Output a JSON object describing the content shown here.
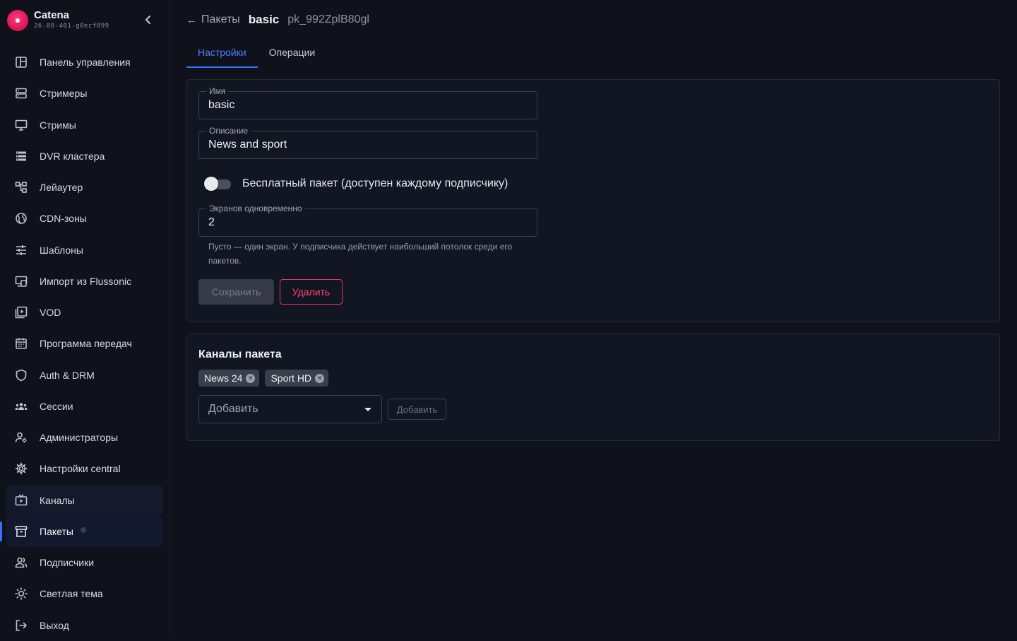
{
  "brand": {
    "name": "Catena",
    "version": "26.08-401-g0ecf899",
    "logo_color": "#d8154f"
  },
  "sidebar": {
    "items": [
      {
        "label": "Панель управления",
        "icon": "dashboard-icon"
      },
      {
        "label": "Стримеры",
        "icon": "server-icon"
      },
      {
        "label": "Стримы",
        "icon": "monitor-icon"
      },
      {
        "label": "DVR кластера",
        "icon": "storage-icon"
      },
      {
        "label": "Лейаутер",
        "icon": "layout-tree-icon"
      },
      {
        "label": "CDN-зоны",
        "icon": "globe-icon"
      },
      {
        "label": "Шаблоны",
        "icon": "sliders-icon"
      },
      {
        "label": "Импорт из Flussonic",
        "icon": "import-icon"
      },
      {
        "label": "VOD",
        "icon": "video-library-icon"
      },
      {
        "label": "Программа передач",
        "icon": "calendar-icon"
      },
      {
        "label": "Auth & DRM",
        "icon": "shield-icon"
      },
      {
        "label": "Сессии",
        "icon": "groups-icon"
      },
      {
        "label": "Администраторы",
        "icon": "admin-icon"
      },
      {
        "label": "Настройки central",
        "icon": "gear-icon"
      },
      {
        "label": "Каналы",
        "icon": "tv-icon"
      },
      {
        "label": "Пакеты",
        "icon": "package-icon"
      },
      {
        "label": "Подписчики",
        "icon": "people-icon"
      },
      {
        "label": "Светлая тема",
        "icon": "sun-icon"
      },
      {
        "label": "Выход",
        "icon": "logout-icon"
      }
    ]
  },
  "breadcrumb": {
    "back_label": "Пакеты",
    "title": "basic",
    "id": "pk_992ZplB80gl"
  },
  "tabs": [
    {
      "label": "Настройки",
      "active": true
    },
    {
      "label": "Операции",
      "active": false
    }
  ],
  "form": {
    "name": {
      "label": "Имя",
      "value": "basic"
    },
    "description": {
      "label": "Описание",
      "value": "News and sport"
    },
    "free_toggle": {
      "label": "Бесплатный пакет (доступен каждому подписчику)",
      "checked": false
    },
    "screens": {
      "label": "Экранов одновременно",
      "value": "2"
    },
    "helper": "Пусто — один экран. У подписчика действует наибольший потолок среди его пакетов.",
    "save_label": "Сохранить",
    "delete_label": "Удалить"
  },
  "channels": {
    "title": "Каналы пакета",
    "chips": [
      "News 24",
      "Sport HD"
    ],
    "select_placeholder": "Добавить",
    "add_label": "Добавить"
  },
  "colors": {
    "accent": "#3d6cff",
    "danger": "#e2385a",
    "background": "#0f111b",
    "card": "#121522"
  }
}
